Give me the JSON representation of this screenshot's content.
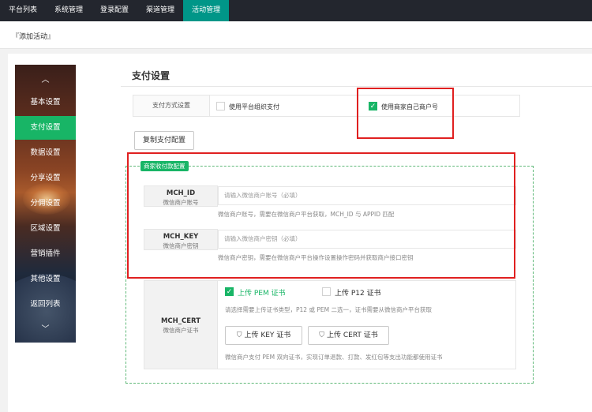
{
  "topnav": {
    "items": [
      {
        "label": "平台列表"
      },
      {
        "label": "系统管理"
      },
      {
        "label": "登录配置"
      },
      {
        "label": "渠道管理"
      },
      {
        "label": "活动管理",
        "active": true
      }
    ]
  },
  "breadcrumb": "『添加活动』",
  "sidemenu": {
    "up_arrow": "︿",
    "down_arrow": "﹀",
    "items": [
      {
        "label": "基本设置"
      },
      {
        "label": "支付设置",
        "active": true
      },
      {
        "label": "数据设置"
      },
      {
        "label": "分享设置"
      },
      {
        "label": "分佣设置"
      },
      {
        "label": "区域设置"
      },
      {
        "label": "营销插件"
      },
      {
        "label": "其他设置"
      },
      {
        "label": "返回列表"
      }
    ]
  },
  "section_title": "支付设置",
  "pay_method": {
    "label": "支付方式设置",
    "option1": {
      "label": "使用平台组织支付",
      "checked": false
    },
    "option2": {
      "label": "使用商家自己商户号",
      "checked": true
    }
  },
  "copy_button": "复制支付配置",
  "merchant_section": {
    "tag": "商家收付款配置",
    "mch_id": {
      "label": "MCH_ID",
      "sublabel": "微信商户账号",
      "placeholder": "请输入微信商户账号（必填）",
      "help": "微信商户账号，需要在微信商户平台获取，MCH_ID 与 APPID 匹配"
    },
    "mch_key": {
      "label": "MCH_KEY",
      "sublabel": "微信商户密钥",
      "placeholder": "请输入微信商户密钥（必填）",
      "help": "微信商户密钥，需要在微信商户平台操作设置操作密码并获取商户接口密钥"
    },
    "mch_cert": {
      "label": "MCH_CERT",
      "sublabel": "微信商户证书",
      "pem_option": {
        "label": "上传 PEM 证书",
        "checked": true
      },
      "p12_option": {
        "label": "上传 P12 证书",
        "checked": false
      },
      "hint": "请选择需要上传证书类型，P12 或 PEM 二选一，证书需要从微信商户平台获取",
      "key_button": "上传 KEY 证书",
      "cert_button": "上传 CERT 证书",
      "help": "微信商户支付 PEM 双向证书，实现订单退款、打款、发红包等支出功能都使用证书"
    }
  },
  "colors": {
    "nav_bg": "#23262e",
    "nav_active": "#009688",
    "accent_green": "#18b566",
    "highlight_red": "#e02020"
  }
}
